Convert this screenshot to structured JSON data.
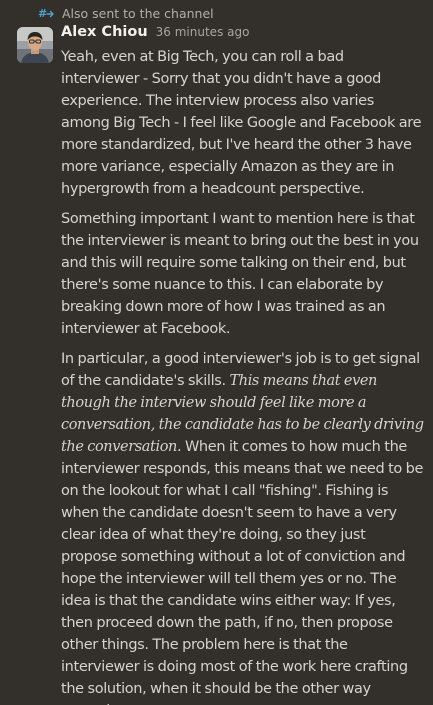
{
  "thread_note": {
    "text": "Also sent to the channel",
    "icon": "thread-reply-icon"
  },
  "message": {
    "author": "Alex Chiou",
    "timestamp": "36 minutes ago",
    "avatar_icon": "user-avatar",
    "paragraphs": [
      "Yeah, even at Big Tech, you can roll a bad interviewer - Sorry that you didn't have a good experience. The interview process also varies among Big Tech - I feel like Google and Facebook are more standardized, but I've heard the other 3 have more variance, especially Amazon as they are in hypergrowth from a headcount perspective.",
      "Something important I want to mention here is that the interviewer is meant to bring out the best in you and this will require some talking on their end, but there's some nuance to this. I can elaborate by breaking down more of how I was trained as an interviewer at Facebook."
    ],
    "paragraph3": {
      "lead": "In particular, a good interviewer's job is to get signal of the candidate's skills. ",
      "emphasis": "This means that even though the interview should feel like more a conversation, the candidate has to be clearly driving the conversation.",
      "rest": " When it comes to how much the interviewer responds, this means that we need to be on the lookout for what I call \"fishing\". Fishing is when the candidate doesn't seem to have a very clear idea of what they're doing, so they just propose something without a lot of conviction and hope the interviewer will tell them yes or no. The idea is that the candidate wins either way: If yes, then proceed down the path, if no, then propose other things. The problem here is that the interviewer is doing most of the work here crafting the solution, when it should be the other way around."
    }
  },
  "colors": {
    "background": "#33302b",
    "text": "#d6d3ce",
    "author": "#f2f0ec",
    "muted": "#a9a59e",
    "thread_icon": "#4ea3d6"
  }
}
